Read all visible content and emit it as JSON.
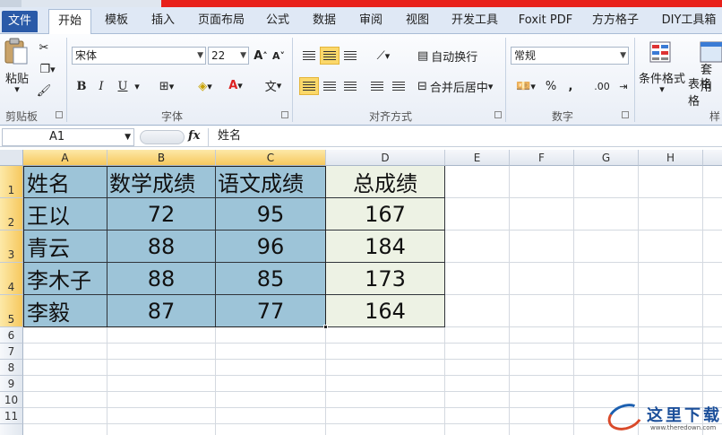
{
  "tabs": [
    "文件",
    "开始",
    "模板",
    "插入",
    "页面布局",
    "公式",
    "数据",
    "审阅",
    "视图",
    "开发工具",
    "Foxit PDF",
    "方方格子",
    "DIY工具箱"
  ],
  "ribbon": {
    "clipboard": {
      "paste_label": "粘贴",
      "group_label": "剪贴板"
    },
    "font": {
      "font_name": "宋体",
      "font_size": "22",
      "group_label": "字体",
      "bold": "B",
      "italic": "I",
      "underline": "U"
    },
    "alignment": {
      "wrap_text": "自动换行",
      "merge_center": "合并后居中",
      "group_label": "对齐方式"
    },
    "number": {
      "format": "常规",
      "percent": "%",
      "comma": ",",
      "inc_decimal": ".00",
      "group_label": "数字"
    },
    "styles": {
      "conditional": "条件格式",
      "table_format": "套用",
      "table_format2": "表格格",
      "group_label": "样"
    }
  },
  "formula_bar": {
    "name_box": "A1",
    "fx": "fx",
    "content": "姓名"
  },
  "columns": [
    "A",
    "B",
    "C",
    "D",
    "E",
    "F",
    "G",
    "H"
  ],
  "rows": [
    "1",
    "2",
    "3",
    "4",
    "5",
    "6",
    "7",
    "8",
    "9",
    "10",
    "11"
  ],
  "table": {
    "headers": [
      "姓名",
      "数学成绩",
      "语文成绩",
      "总成绩"
    ],
    "data": [
      [
        "王以",
        "72",
        "95",
        "167"
      ],
      [
        "青云",
        "88",
        "96",
        "184"
      ],
      [
        "李木子",
        "88",
        "85",
        "173"
      ],
      [
        "李毅",
        "87",
        "77",
        "164"
      ]
    ]
  },
  "watermark": {
    "title": "这里下载",
    "url": "www.theredown.com"
  }
}
